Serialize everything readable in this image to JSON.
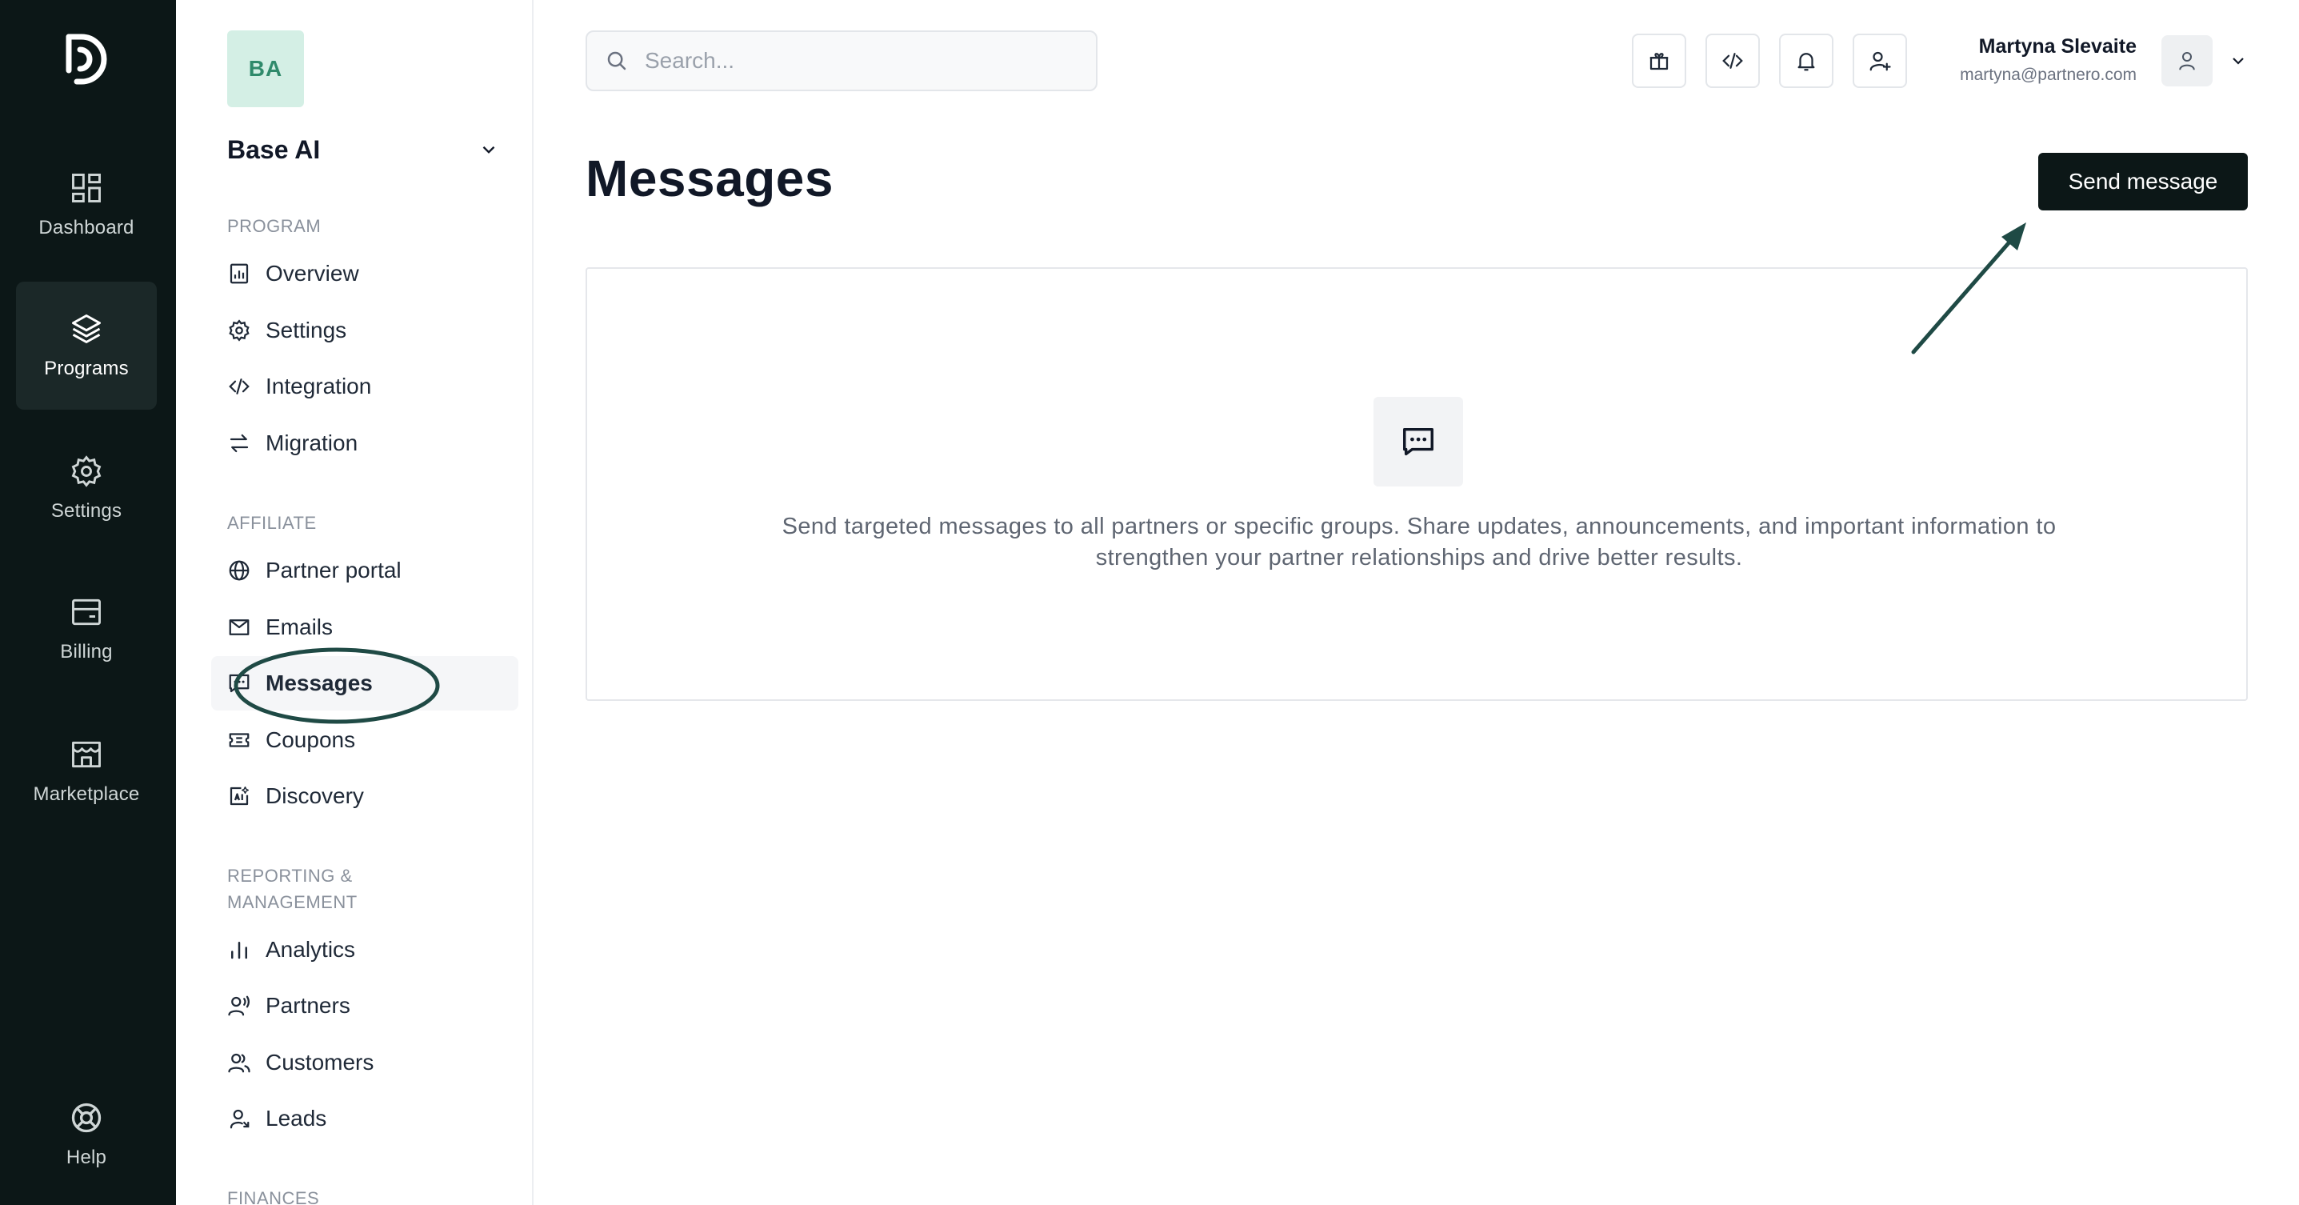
{
  "rail": {
    "items": [
      {
        "label": "Dashboard",
        "icon": "dashboard-icon"
      },
      {
        "label": "Programs",
        "icon": "layers-icon"
      },
      {
        "label": "Settings",
        "icon": "gear-icon"
      },
      {
        "label": "Billing",
        "icon": "billing-icon"
      },
      {
        "label": "Marketplace",
        "icon": "store-icon"
      },
      {
        "label": "Help",
        "icon": "lifebuoy-icon"
      }
    ]
  },
  "sidebar": {
    "org_initials": "BA",
    "org_name": "Base AI",
    "sections": {
      "program": "PROGRAM",
      "affiliate": "AFFILIATE",
      "reporting": "REPORTING & MANAGEMENT",
      "finances": "FINANCES"
    },
    "program_items": [
      "Overview",
      "Settings",
      "Integration",
      "Migration"
    ],
    "affiliate_items": [
      "Partner portal",
      "Emails",
      "Messages",
      "Coupons",
      "Discovery"
    ],
    "reporting_items": [
      "Analytics",
      "Partners",
      "Customers",
      "Leads"
    ]
  },
  "header": {
    "search_placeholder": "Search...",
    "user_name": "Martyna Slevaite",
    "user_email": "martyna@partnero.com"
  },
  "main": {
    "title": "Messages",
    "send_button": "Send message",
    "empty_text": "Send targeted messages to all partners or specific groups. Share updates, announcements, and important information to strengthen your partner relationships and drive better results."
  },
  "colors": {
    "rail_bg": "#0c1717",
    "accent_green": "#2f8a6b",
    "annotation": "#1f4a45"
  }
}
